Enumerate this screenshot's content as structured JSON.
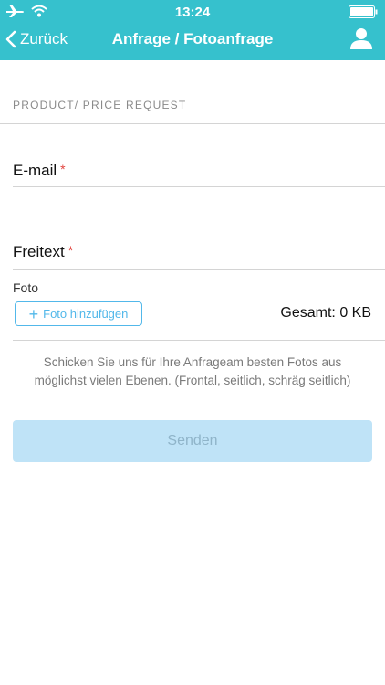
{
  "status_bar": {
    "time": "13:24",
    "icons": [
      "airplane-icon",
      "wifi-icon",
      "battery-icon"
    ]
  },
  "nav": {
    "back_label": "Zurück",
    "title": "Anfrage / Fotoanfrage",
    "right_icon": "user-icon"
  },
  "form": {
    "section_header": "PRODUCT/ PRICE REQUEST",
    "email": {
      "label": "E-mail",
      "required_marker": "*",
      "value": ""
    },
    "freitext": {
      "label": "Freitext",
      "required_marker": "*",
      "value": ""
    },
    "foto": {
      "label": "Foto",
      "add_button_label": "Foto hinzufügen",
      "total_label": "Gesamt: 0 KB"
    },
    "hint": "Schicken Sie uns für Ihre Anfrageam besten Fotos aus möglichst vielen Ebenen. (Frontal, seitlich, schräg seitlich)",
    "send_label": "Senden"
  },
  "colors": {
    "header_bg": "#36c1cd",
    "required": "#e2443e",
    "accent": "#52b8ea",
    "send_bg_disabled": "#bfe3f7"
  }
}
